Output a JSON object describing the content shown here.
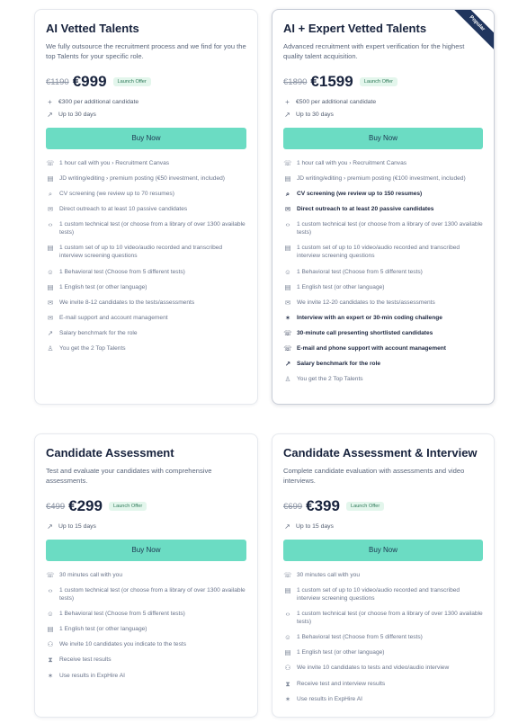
{
  "plans": [
    {
      "title": "AI Vetted Talents",
      "description": "We fully outsource the recruitment process and we find for you the top Talents for your specific role.",
      "old_price": "€1190",
      "price": "€999",
      "badge": "Launch Offer",
      "extras": [
        {
          "icon": "plus-icon",
          "text": "€300 per additional candidate"
        },
        {
          "icon": "trend-icon",
          "text": "Up to 30 days"
        }
      ],
      "button": "Buy Now",
      "features": [
        {
          "icon": "phone-icon",
          "text": "1 hour call with you › Recruitment Canvas"
        },
        {
          "icon": "document-icon",
          "text": "JD writing/editing › premium posting (€50 investment, included)"
        },
        {
          "icon": "search-icon",
          "text": "CV screening (we review up to 70 resumes)"
        },
        {
          "icon": "mail-icon",
          "text": "Direct outreach to at least 10 passive candidates"
        },
        {
          "icon": "code-icon",
          "text": "1 custom technical test (or choose from a library of over 1300 available tests)"
        },
        {
          "icon": "document-icon",
          "text": "1 custom set of up to 10 video/audio recorded and transcribed interview screening questions"
        },
        {
          "icon": "user-icon",
          "text": "1 Behavioral test (Choose from 5 different tests)"
        },
        {
          "icon": "document-icon",
          "text": "1 English test (or other language)"
        },
        {
          "icon": "mail-icon",
          "text": "We invite 8-12 candidates to the tests/assessments"
        },
        {
          "icon": "mail-icon",
          "text": "E-mail support and account management"
        },
        {
          "icon": "chart-icon",
          "text": "Salary benchmark for the role"
        },
        {
          "icon": "award-icon",
          "text": "You get the 2 Top Talents"
        }
      ]
    },
    {
      "title": "AI + Expert Vetted Talents",
      "description": "Advanced recruitment with expert verification for the highest quality talent acquisition.",
      "old_price": "€1890",
      "price": "€1599",
      "badge": "Launch Offer",
      "ribbon": "Popular",
      "extras": [
        {
          "icon": "plus-icon",
          "text": "€500 per additional candidate"
        },
        {
          "icon": "trend-icon",
          "text": "Up to 30 days"
        }
      ],
      "button": "Buy Now",
      "features": [
        {
          "icon": "phone-icon",
          "text": "1 hour call with you › Recruitment Canvas"
        },
        {
          "icon": "document-icon",
          "text": "JD writing/editing › premium posting (€100 investment, included)"
        },
        {
          "icon": "search-icon",
          "text": "CV screening (we review up to 150 resumes)",
          "strong": true
        },
        {
          "icon": "mail-icon",
          "text": "Direct outreach to at least 20 passive candidates",
          "strong": true
        },
        {
          "icon": "code-icon",
          "text": "1 custom technical test (or choose from a library of over 1300 available tests)"
        },
        {
          "icon": "document-icon",
          "text": "1 custom set of up to 10 video/audio recorded and transcribed interview screening questions"
        },
        {
          "icon": "user-icon",
          "text": "1 Behavioral test (Choose from 5 different tests)"
        },
        {
          "icon": "document-icon",
          "text": "1 English test (or other language)"
        },
        {
          "icon": "mail-icon",
          "text": "We invite 12-20 candidates to the tests/assessments"
        },
        {
          "icon": "star-icon",
          "text": "Interview with an expert or 30-min coding challenge",
          "strong": true
        },
        {
          "icon": "phone-icon",
          "text": "30-minute call presenting shortlisted candidates",
          "strong": true
        },
        {
          "icon": "phone-icon",
          "text": "E-mail and phone support with account management",
          "strong": true
        },
        {
          "icon": "chart-icon",
          "text": "Salary benchmark for the role",
          "strong": true
        },
        {
          "icon": "award-icon",
          "text": "You get the 2 Top Talents"
        }
      ]
    },
    {
      "title": "Candidate Assessment",
      "description": "Test and evaluate your candidates with comprehensive assessments.",
      "old_price": "€499",
      "price": "€299",
      "badge": "Launch Offer",
      "extras": [
        {
          "icon": "trend-icon",
          "text": "Up to 15 days"
        }
      ],
      "button": "Buy Now",
      "features": [
        {
          "icon": "phone-icon",
          "text": "30 minutes call with you"
        },
        {
          "icon": "code-icon",
          "text": "1 custom technical test (or choose from a library of over 1300 available tests)"
        },
        {
          "icon": "user-icon",
          "text": "1 Behavioral test (Choose from 5 different tests)"
        },
        {
          "icon": "document-icon",
          "text": "1 English test (or other language)"
        },
        {
          "icon": "users-icon",
          "text": "We invite 10 candidates you indicate to the tests"
        },
        {
          "icon": "hourglass-icon",
          "text": "Receive test results"
        },
        {
          "icon": "star-icon",
          "text": "Use results in ExpHire AI"
        }
      ]
    },
    {
      "title": "Candidate Assessment & Interview",
      "description": "Complete candidate evaluation with assessments and video interviews.",
      "old_price": "€699",
      "price": "€399",
      "badge": "Launch Offer",
      "extras": [
        {
          "icon": "trend-icon",
          "text": "Up to 15 days"
        }
      ],
      "button": "Buy Now",
      "features": [
        {
          "icon": "phone-icon",
          "text": "30 minutes call with you"
        },
        {
          "icon": "document-icon",
          "text": "1 custom set of up to 10 video/audio recorded and transcribed interview screening questions"
        },
        {
          "icon": "code-icon",
          "text": "1 custom technical test (or choose from a library of over 1300 available tests)"
        },
        {
          "icon": "user-icon",
          "text": "1 Behavioral test (Choose from 5 different tests)"
        },
        {
          "icon": "document-icon",
          "text": "1 English test (or other language)"
        },
        {
          "icon": "users-icon",
          "text": "We invite 10 candidates to tests and video/audio interview"
        },
        {
          "icon": "hourglass-icon",
          "text": "Receive test and interview results"
        },
        {
          "icon": "star-icon",
          "text": "Use results in ExpHire AI"
        }
      ]
    }
  ],
  "colors": {
    "accent": "#6bdcc3",
    "ribbon": "#20355e",
    "badge_bg": "#e3f6ec",
    "badge_text": "#2f7a5a"
  }
}
